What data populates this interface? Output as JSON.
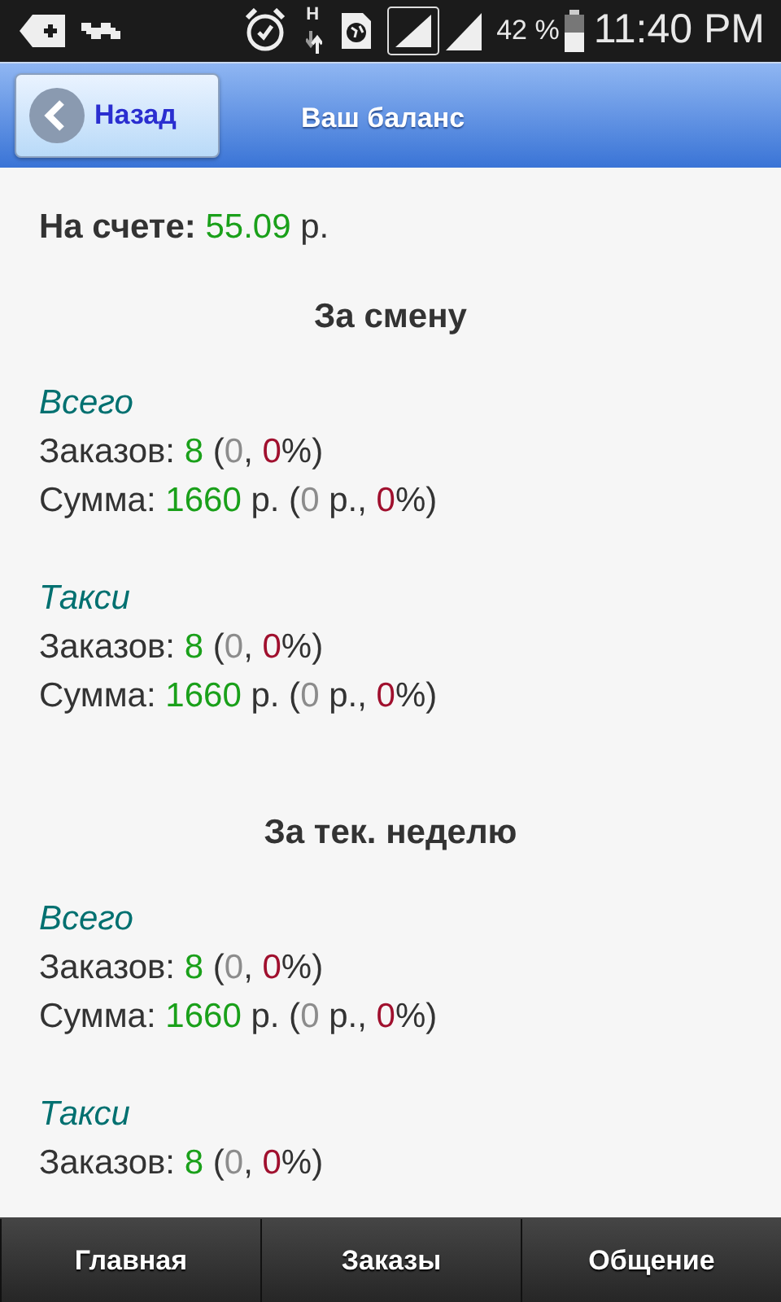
{
  "status_bar": {
    "network_type": "H",
    "battery_text": "42 %",
    "time": "11:40 PM"
  },
  "header": {
    "back_button": "Назад",
    "title": "Ваш баланс"
  },
  "balance": {
    "label": "На счете:",
    "amount": "55.09",
    "unit": "р."
  },
  "periods": [
    {
      "title": "За смену",
      "groups": [
        {
          "title": "Всего",
          "lines": [
            [
              {
                "text": "Заказов: ",
                "kind": "plain"
              },
              {
                "text": "8",
                "kind": "good"
              },
              {
                "text": " (",
                "kind": "plain"
              },
              {
                "text": "0",
                "kind": "muted"
              },
              {
                "text": ", ",
                "kind": "plain"
              },
              {
                "text": "0",
                "kind": "bad"
              },
              {
                "text": "%)",
                "kind": "plain"
              }
            ],
            [
              {
                "text": "Сумма: ",
                "kind": "plain"
              },
              {
                "text": "1660",
                "kind": "good"
              },
              {
                "text": " р. (",
                "kind": "plain"
              },
              {
                "text": "0",
                "kind": "muted"
              },
              {
                "text": " р., ",
                "kind": "plain"
              },
              {
                "text": "0",
                "kind": "bad"
              },
              {
                "text": "%)",
                "kind": "plain"
              }
            ]
          ]
        },
        {
          "title": "Такси",
          "lines": [
            [
              {
                "text": "Заказов: ",
                "kind": "plain"
              },
              {
                "text": "8",
                "kind": "good"
              },
              {
                "text": " (",
                "kind": "plain"
              },
              {
                "text": "0",
                "kind": "muted"
              },
              {
                "text": ", ",
                "kind": "plain"
              },
              {
                "text": "0",
                "kind": "bad"
              },
              {
                "text": "%)",
                "kind": "plain"
              }
            ],
            [
              {
                "text": "Сумма: ",
                "kind": "plain"
              },
              {
                "text": "1660",
                "kind": "good"
              },
              {
                "text": " р. (",
                "kind": "plain"
              },
              {
                "text": "0",
                "kind": "muted"
              },
              {
                "text": " р., ",
                "kind": "plain"
              },
              {
                "text": "0",
                "kind": "bad"
              },
              {
                "text": "%)",
                "kind": "plain"
              }
            ]
          ]
        }
      ]
    },
    {
      "title": "За тек. неделю",
      "groups": [
        {
          "title": "Всего",
          "lines": [
            [
              {
                "text": "Заказов: ",
                "kind": "plain"
              },
              {
                "text": "8",
                "kind": "good"
              },
              {
                "text": " (",
                "kind": "plain"
              },
              {
                "text": "0",
                "kind": "muted"
              },
              {
                "text": ", ",
                "kind": "plain"
              },
              {
                "text": "0",
                "kind": "bad"
              },
              {
                "text": "%)",
                "kind": "plain"
              }
            ],
            [
              {
                "text": "Сумма: ",
                "kind": "plain"
              },
              {
                "text": "1660",
                "kind": "good"
              },
              {
                "text": " р. (",
                "kind": "plain"
              },
              {
                "text": "0",
                "kind": "muted"
              },
              {
                "text": " р., ",
                "kind": "plain"
              },
              {
                "text": "0",
                "kind": "bad"
              },
              {
                "text": "%)",
                "kind": "plain"
              }
            ]
          ]
        },
        {
          "title": "Такси",
          "lines": [
            [
              {
                "text": "Заказов: ",
                "kind": "plain"
              },
              {
                "text": "8",
                "kind": "good"
              },
              {
                "text": " (",
                "kind": "plain"
              },
              {
                "text": "0",
                "kind": "muted"
              },
              {
                "text": ", ",
                "kind": "plain"
              },
              {
                "text": "0",
                "kind": "bad"
              },
              {
                "text": "%)",
                "kind": "plain"
              }
            ]
          ]
        }
      ]
    }
  ],
  "tabbar": [
    {
      "label": "Главная"
    },
    {
      "label": "Заказы"
    },
    {
      "label": "Общение"
    }
  ]
}
